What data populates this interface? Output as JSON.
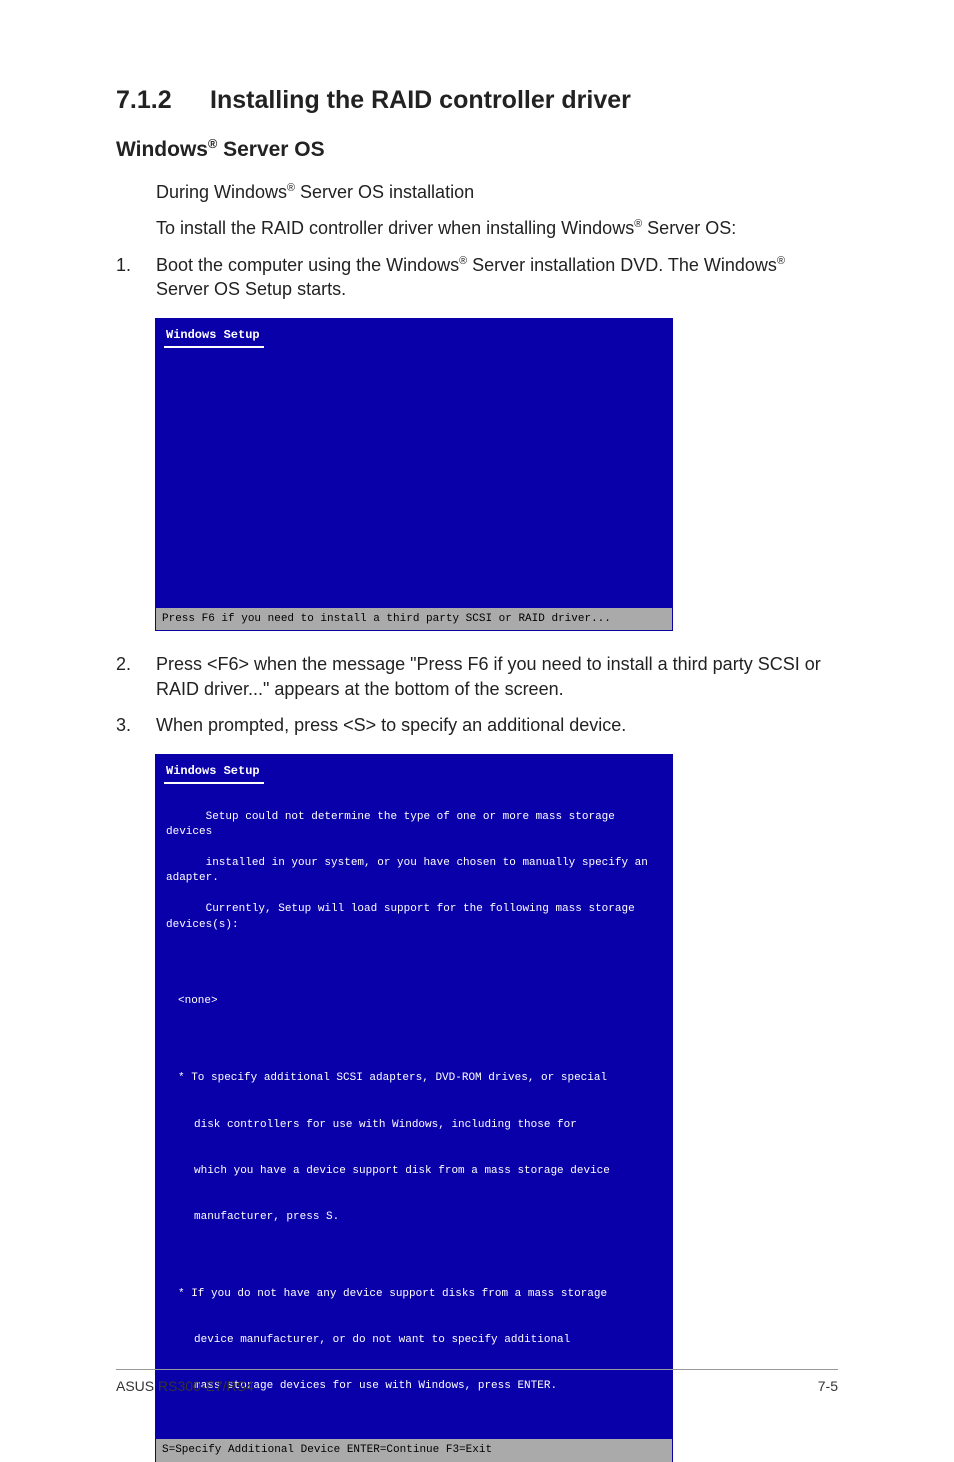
{
  "heading": {
    "num": "7.1.2",
    "title": "Installing the RAID controller driver"
  },
  "sub_pre": "Windows",
  "sub_sup": "®",
  "sub_post": " Server OS",
  "p1_pre": "During Windows",
  "p1_sup": "®",
  "p1_post": " Server OS installation",
  "p2_pre": "To install the RAID controller driver when installing Windows",
  "p2_sup": "®",
  "p2_post": " Server OS:",
  "step1": {
    "n": "1.",
    "t1_pre": "Boot the computer using the Windows",
    "t1_sup": "®",
    "t1_post": " Server installation DVD. The Windows",
    "t1_sup2": "®",
    "t1_post2": " Server OS Setup starts."
  },
  "ss1": {
    "title": "Windows Setup",
    "status": "Press F6 if you need to install a third party SCSI or RAID driver..."
  },
  "step2": {
    "n": "2.",
    "t": "Press <F6> when the message \"Press F6 if you need to install a third party SCSI or RAID driver...\" appears at the bottom of the screen."
  },
  "step3": {
    "n": "3.",
    "t": "When prompted, press <S> to specify an additional device."
  },
  "ss2": {
    "title": "Windows Setup",
    "line1": "Setup could not determine the type of one or more mass storage devices",
    "line2": "installed in your system, or you have chosen to manually specify an adapter.",
    "line3": "Currently, Setup will load support for the following mass storage devices(s):",
    "none": "<none>",
    "b1l1": "* To specify additional SCSI adapters, DVD-ROM drives, or special",
    "b1l2": "disk controllers for use with Windows, including those for",
    "b1l3": "which you have a device support disk from a mass storage device",
    "b1l4": "manufacturer, press S.",
    "b2l1": "* If you do not have any device support disks from a mass storage",
    "b2l2": "device manufacturer, or do not want to specify additional",
    "b2l3": "mass storage devices for use with Windows, press ENTER.",
    "status": "S=Specify Additional Device    ENTER=Continue    F3=Exit"
  },
  "footer": {
    "left": "ASUS RS300-E7/RS4",
    "right": "7-5"
  }
}
